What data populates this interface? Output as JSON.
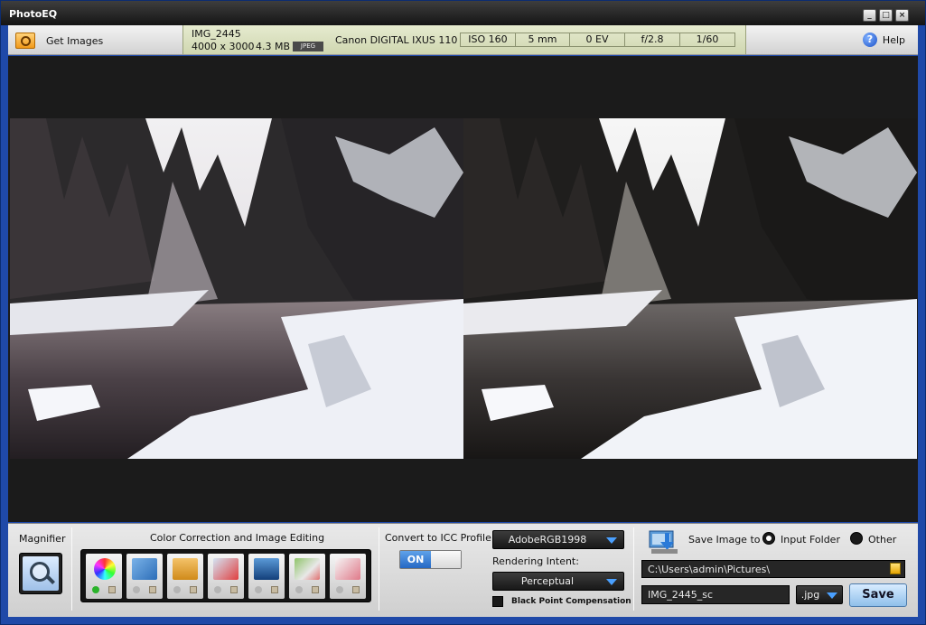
{
  "window": {
    "title": "PhotoEQ"
  },
  "toolbar": {
    "get_images_label": "Get Images",
    "help_label": "Help"
  },
  "file_info": {
    "name": "IMG_2445",
    "dimensions": "4000 x 3000",
    "size": "4.3 MB",
    "format": "JPEG",
    "camera": "Canon DIGITAL IXUS 110",
    "exif": [
      "ISO 160",
      "5 mm",
      "0 EV",
      "f/2.8",
      "1/60"
    ]
  },
  "magnifier": {
    "title": "Magnifier"
  },
  "color_correction": {
    "title": "Color Correction and Image Editing",
    "tools": [
      "color",
      "rotate",
      "crop",
      "resize",
      "frame",
      "watermark",
      "red-eye"
    ]
  },
  "icc": {
    "title": "Convert to ICC Profile",
    "toggle_on_label": "ON",
    "profile": "AdobeRGB1998",
    "rendering_intent_label": "Rendering Intent:",
    "rendering_intent": "Perceptual",
    "black_point_label": "Black Point Compensation"
  },
  "save": {
    "title": "Save Image to",
    "option_input": "Input Folder",
    "option_other": "Other",
    "selected_option": "input",
    "path": "C:\\Users\\admin\\Pictures\\",
    "filename": "IMG_2445_sc",
    "format": ".jpg",
    "button_label": "Save"
  },
  "colors": {
    "accent": "#4aa0ff",
    "title_bar": "#1b1b1b",
    "window_frame": "#1f49a8",
    "info_bar": "#dbe1bf"
  }
}
